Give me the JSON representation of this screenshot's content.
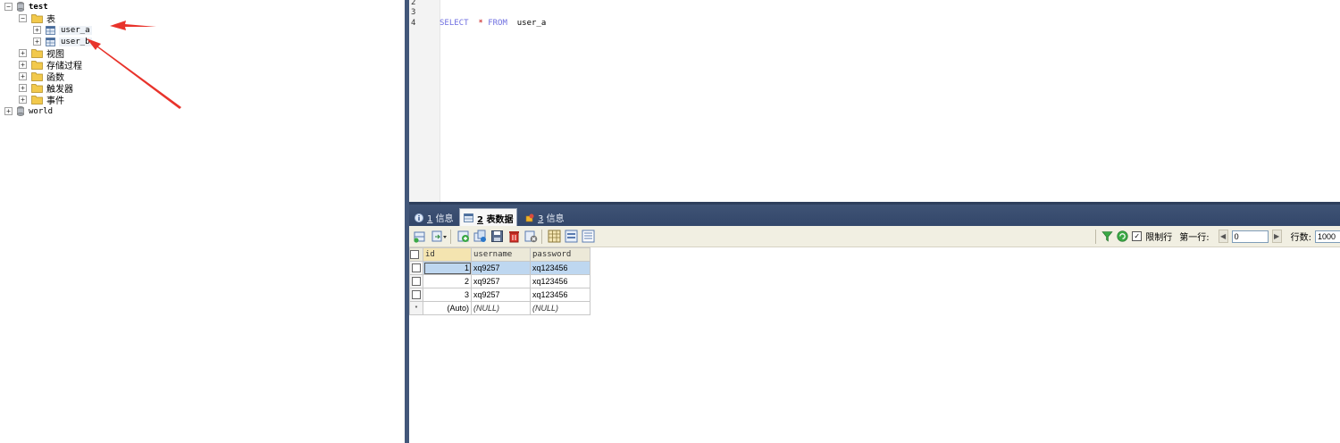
{
  "tree": {
    "db_test": "test",
    "folder_tables": "表",
    "table_a": "user_a",
    "table_b": "user_b",
    "folder_views": "视图",
    "folder_procs": "存储过程",
    "folder_funcs": "函数",
    "folder_triggers": "触发器",
    "folder_events": "事件",
    "db_world": "world",
    "expand_glyph": "+",
    "collapse_glyph": "−"
  },
  "editor": {
    "line_numbers": [
      "2",
      "3",
      "4"
    ],
    "code": {
      "kw_select": "SELECT",
      "star": "*",
      "kw_from": "FROM",
      "table": "user_a"
    }
  },
  "results": {
    "tabs": [
      {
        "num": "1",
        "label": "信息"
      },
      {
        "num": "2",
        "label": "表数据"
      },
      {
        "num": "3",
        "label": "信息"
      }
    ],
    "toolbar": {
      "limit_label": "限制行",
      "limit_checked": "✓",
      "first_row_label": "第一行:",
      "first_row_value": "0",
      "rows_label": "行数:",
      "rows_value": "1000"
    },
    "grid": {
      "columns": [
        "id",
        "username",
        "password"
      ],
      "rows": [
        {
          "id": "1",
          "username": "xq9257",
          "password": "xq123456"
        },
        {
          "id": "2",
          "username": "xq9257",
          "password": "xq123456"
        },
        {
          "id": "3",
          "username": "xq9257",
          "password": "xq123456"
        }
      ],
      "new_row": {
        "marker": "*",
        "id": "(Auto)",
        "username": "(NULL)",
        "password": "(NULL)"
      }
    }
  },
  "colors": {
    "tab_bar": "#3f5375",
    "annotation_arrow": "#e8332b",
    "selected_row": "#bed7f0",
    "keyword": "#6e6ee0"
  }
}
